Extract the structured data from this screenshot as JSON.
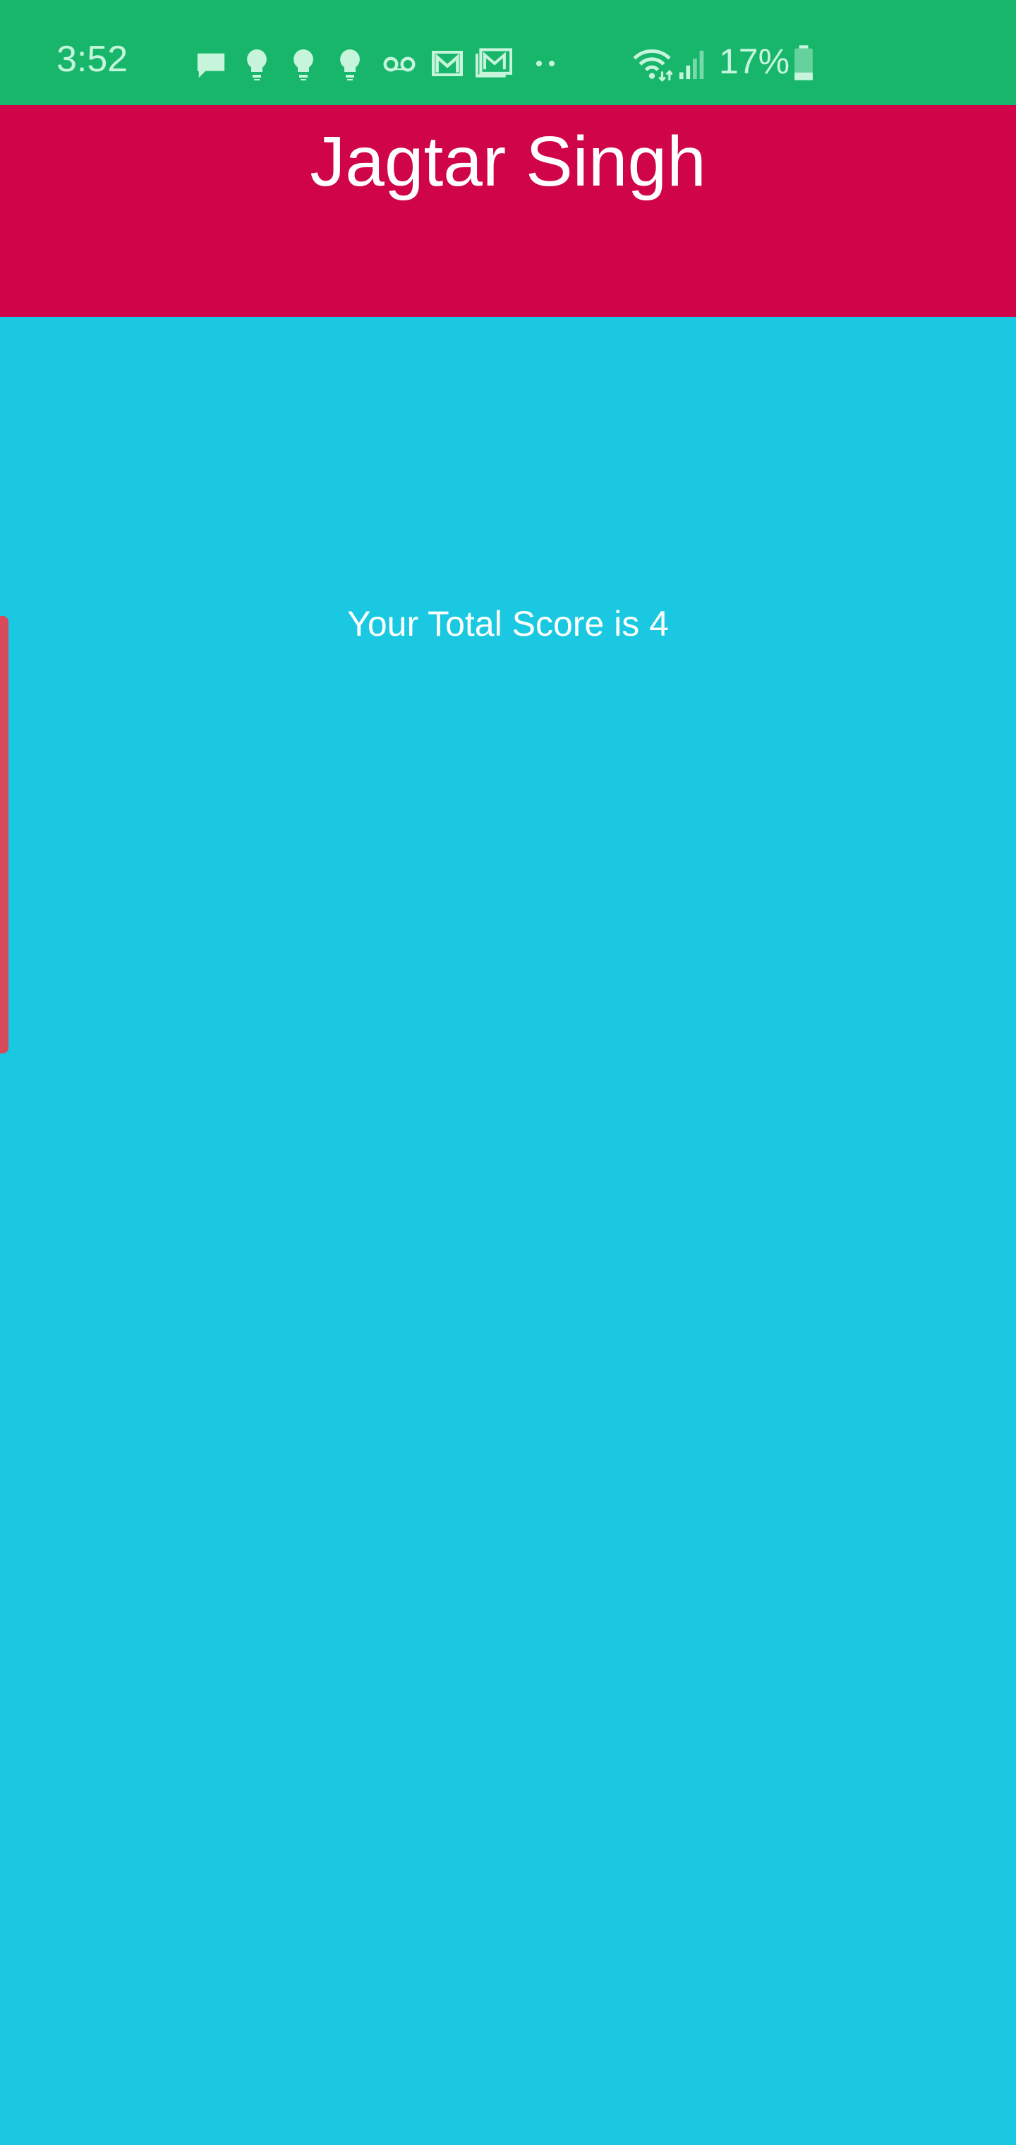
{
  "status_bar": {
    "time": "3:52",
    "battery_percent": "17%",
    "notification_icons": [
      "message-icon",
      "bulb-icon",
      "bulb-icon",
      "bulb-icon",
      "voicemail-icon",
      "gmail-icon",
      "gmail-stack-icon",
      "more-dots-icon"
    ],
    "system_icons": [
      "wifi-icon",
      "signal-icon",
      "battery-icon"
    ],
    "colors": {
      "background": "#17b66b",
      "foreground": "#c6f5dc"
    }
  },
  "header": {
    "title": "Jagtar Singh",
    "background": "#d00449"
  },
  "main": {
    "score_text": "Your Total Score is 4",
    "background": "#1ac9e1"
  },
  "edge_panel": {
    "color": "#d64a5a"
  }
}
